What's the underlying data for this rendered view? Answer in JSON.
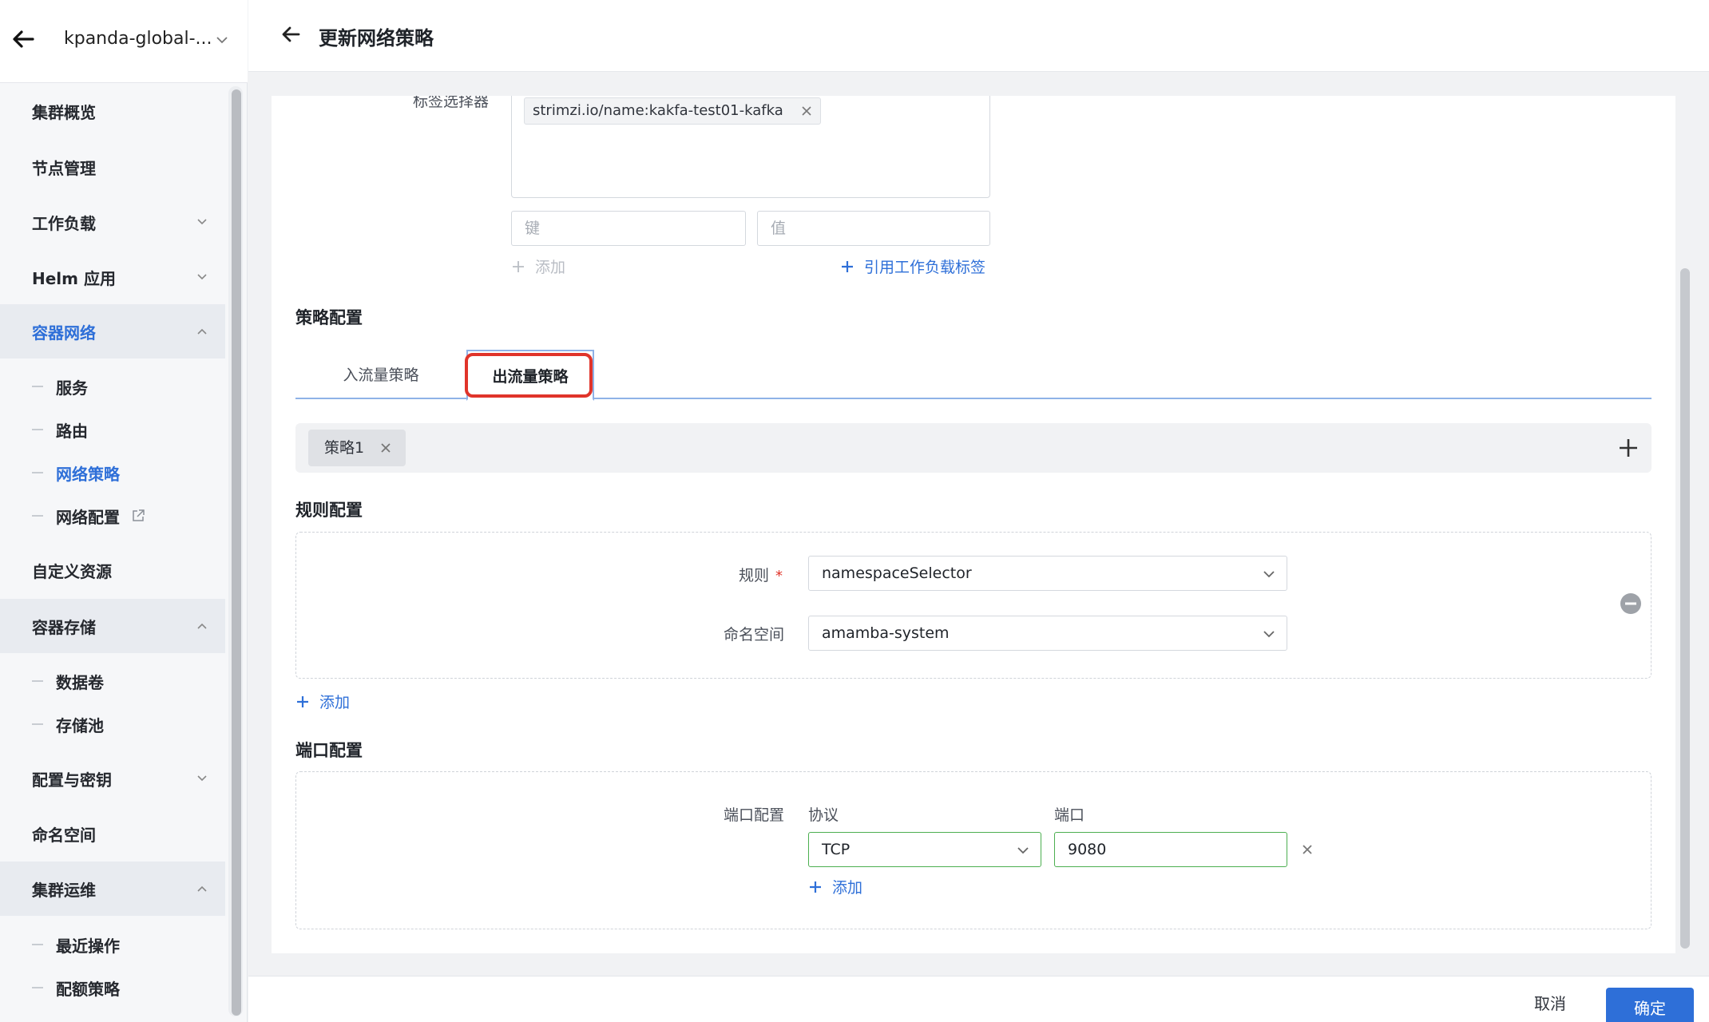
{
  "sidebar": {
    "cluster_name": "kpanda-global-...",
    "items": {
      "overview": "集群概览",
      "nodes": "节点管理",
      "workloads": "工作负载",
      "helm": "Helm 应用",
      "network": "容器网络",
      "network_services": "服务",
      "network_routes": "路由",
      "network_policy": "网络策略",
      "network_config": "网络配置",
      "custom_resources": "自定义资源",
      "storage": "容器存储",
      "storage_volumes": "数据卷",
      "storage_pools": "存储池",
      "config_secrets": "配置与密钥",
      "namespaces": "命名空间",
      "ops": "集群运维",
      "ops_recent": "最近操作",
      "ops_quota": "配额策略"
    }
  },
  "header": {
    "title": "更新网络策略"
  },
  "form": {
    "label_selector_label": "标签选择器",
    "label_selector_tag": "strimzi.io/name:kakfa-test01-kafka",
    "key_placeholder": "键",
    "value_placeholder": "值",
    "add_label": "添加",
    "ref_workload_label": "引用工作负载标签",
    "policy_config_title": "策略配置",
    "tabs": {
      "ingress": "入流量策略",
      "egress": "出流量策略"
    },
    "policy_chip": "策略1",
    "rule_config_title": "规则配置",
    "rule_label": "规则",
    "rule_value": "namespaceSelector",
    "namespace_label": "命名空间",
    "namespace_value": "amamba-system",
    "rule_add": "添加",
    "port_config_title": "端口配置",
    "port_row_label": "端口配置",
    "protocol_header": "协议",
    "port_header": "端口",
    "protocol_value": "TCP",
    "port_value": "9080",
    "port_add": "添加"
  },
  "footer": {
    "cancel": "取消",
    "confirm": "确定"
  },
  "colors": {
    "accent": "#2e6fd8",
    "highlight": "#e0342a",
    "valid_border": "#4caf50"
  }
}
